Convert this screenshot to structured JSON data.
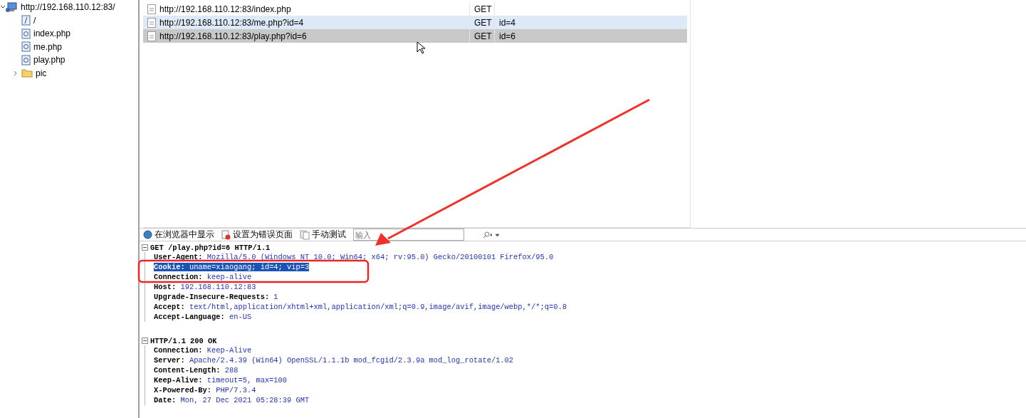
{
  "site_tree": {
    "label": "http://192.168.110.12:83/",
    "expanded": true,
    "children": [
      {
        "label": "/",
        "kind": "page"
      },
      {
        "label": "index.php",
        "kind": "script"
      },
      {
        "label": "me.php",
        "kind": "script"
      },
      {
        "label": "play.php",
        "kind": "script"
      },
      {
        "label": "pic",
        "kind": "folder",
        "expanded": false
      }
    ]
  },
  "requests": [
    {
      "url": "http://192.168.110.12:83/index.php",
      "method": "GET",
      "selected": false,
      "hovered": false
    },
    {
      "url": "http://192.168.110.12:83/me.php?id=4",
      "method": "GET",
      "params": "id=4",
      "selected": false,
      "hovered": true
    },
    {
      "url": "http://192.168.110.12:83/play.php?id=6",
      "method": "GET",
      "params": "id=6",
      "selected": true,
      "hovered": false
    }
  ],
  "toolbar": {
    "buttons": [
      {
        "label": "在浏览器中显示",
        "kind": "browser"
      },
      {
        "label": "设置为错误页面",
        "kind": "error"
      },
      {
        "label": "手动测试",
        "kind": "manual"
      }
    ],
    "search": {
      "placeholder": "输入"
    }
  },
  "blocks": [
    {
      "status_line": "GET /play.php?id=6 HTTP/1.1",
      "expanded": true,
      "headers": [
        {
          "name": "User-Agent:",
          "value": "Mozilla/5.0 (Windows NT 10.0; Win64; x64; rv:95.0) Gecko/20100101 Firefox/95.0",
          "selected": false
        },
        {
          "name": "Cookie:",
          "value": "uname=xiaogang; id=4; vip=3",
          "selected": true
        },
        {
          "name": "Connection:",
          "value": "keep-alive",
          "selected": false
        },
        {
          "name": "Host:",
          "value": "192.168.110.12:83",
          "selected": false
        },
        {
          "name": "Upgrade-Insecure-Requests:",
          "value": "1",
          "selected": false
        },
        {
          "name": "Accept:",
          "value": "text/html,application/xhtml+xml,application/xml;q=0.9,image/avif,image/webp,*/*;q=0.8",
          "selected": false
        },
        {
          "name": "Accept-Language:",
          "value": "en-US",
          "selected": false
        }
      ]
    },
    {
      "status_line": "HTTP/1.1 200 OK",
      "expanded": true,
      "headers": [
        {
          "name": "Connection:",
          "value": "Keep-Alive",
          "selected": false
        },
        {
          "name": "Server:",
          "value": "Apache/2.4.39 (Win64) OpenSSL/1.1.1b mod_fcgid/2.3.9a mod_log_rotate/1.02",
          "selected": false
        },
        {
          "name": "Content-Length:",
          "value": "288",
          "selected": false
        },
        {
          "name": "Keep-Alive:",
          "value": "timeout=5, max=100",
          "selected": false
        },
        {
          "name": "X-Powered-By:",
          "value": "PHP/7.3.4",
          "selected": false
        },
        {
          "name": "Date:",
          "value": "Mon, 27 Dec 2021 05:28:39 GMT",
          "selected": false
        }
      ]
    }
  ]
}
